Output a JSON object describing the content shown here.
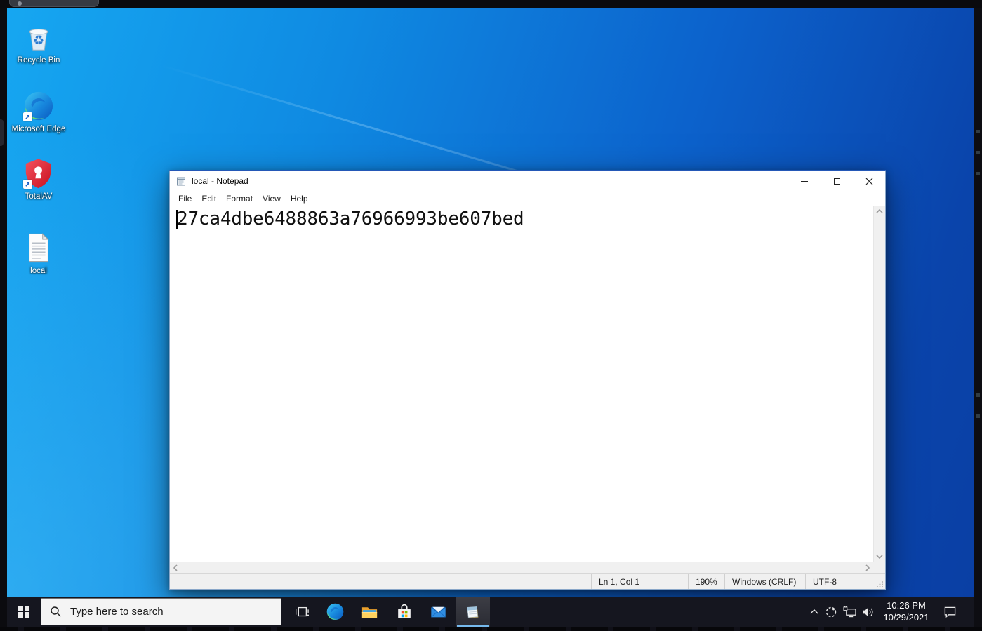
{
  "desktop": {
    "icons": [
      {
        "id": "recycle-bin",
        "label": "Recycle Bin"
      },
      {
        "id": "microsoft-edge",
        "label": "Microsoft Edge",
        "shortcut": true
      },
      {
        "id": "totalav",
        "label": "TotalAV",
        "shortcut": true
      },
      {
        "id": "local-file",
        "label": "local"
      }
    ]
  },
  "notepad": {
    "title": "local - Notepad",
    "menu": [
      "File",
      "Edit",
      "Format",
      "View",
      "Help"
    ],
    "text": "27ca4dbe6488863a76966993be607bed",
    "status": {
      "cursor": "Ln 1, Col 1",
      "zoom": "190%",
      "eol": "Windows (CRLF)",
      "encoding": "UTF-8"
    }
  },
  "taskbar": {
    "search_placeholder": "Type here to search",
    "apps": [
      {
        "name": "task-view",
        "active": false
      },
      {
        "name": "edge",
        "active": false
      },
      {
        "name": "file-explorer",
        "active": false
      },
      {
        "name": "microsoft-store",
        "active": false
      },
      {
        "name": "mail",
        "active": false
      },
      {
        "name": "notepad",
        "active": true
      }
    ],
    "tray": {
      "time": "10:26 PM",
      "date": "10/29/2021"
    }
  },
  "icons": {
    "start-icon": "windows-logo",
    "search-icon": "magnifier",
    "task-view-icon": "stacked-rects",
    "edge-icon": "edge-swirl",
    "file-explorer-icon": "yellow-folder",
    "store-icon": "shopping-bag",
    "mail-icon": "envelope",
    "notepad-icon": "spiral-notepad",
    "hidden-icons-icon": "chevron-up",
    "tray-status-icon": "dashed-circle",
    "network-icon": "monitor-plug",
    "volume-icon": "speaker-waves",
    "action-center-icon": "speech-bubble",
    "minimize-icon": "horizontal-bar",
    "maximize-icon": "square-outline",
    "close-icon": "x-cross",
    "scroll-up-icon": "chevron-up",
    "scroll-down-icon": "chevron-down",
    "scroll-left-icon": "chevron-left",
    "scroll-right-icon": "chevron-right",
    "recycle-bin-icon": "recycle-symbol ♻",
    "shortcut-overlay-icon": "arrow-up-right",
    "resize-grip-icon": "dot-triangle"
  },
  "colors": {
    "desktop_gradient_start": "#16a7f1",
    "desktop_gradient_end": "#0a3fa4",
    "taskbar_bg": "#15161f",
    "active_app_underline": "#76b9ed",
    "window_accent_border": "#2458b7",
    "status_bar_bg": "#f0f0f0",
    "totalav_red": "#e0202f",
    "folder_yellow": "#ffc93e"
  }
}
